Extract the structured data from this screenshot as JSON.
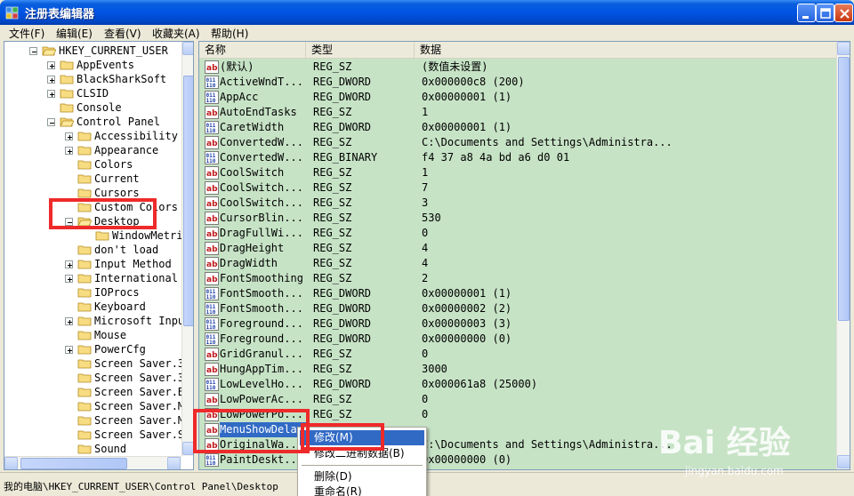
{
  "window": {
    "title": "注册表编辑器"
  },
  "menu": [
    "文件(F)",
    "编辑(E)",
    "查看(V)",
    "收藏夹(A)",
    "帮助(H)"
  ],
  "tree": [
    {
      "label": "HKEY_CURRENT_USER",
      "expander": "minus"
    },
    {
      "label": "AppEvents",
      "expander": "plus"
    },
    {
      "label": "BlackSharkSoft",
      "expander": "plus"
    },
    {
      "label": "CLSID",
      "expander": "plus"
    },
    {
      "label": "Console",
      "expander": ""
    },
    {
      "label": "Control Panel",
      "expander": "minus"
    },
    {
      "label": "Accessibility",
      "expander": "plus"
    },
    {
      "label": "Appearance",
      "expander": "plus"
    },
    {
      "label": "Colors",
      "expander": ""
    },
    {
      "label": "Current",
      "expander": ""
    },
    {
      "label": "Cursors",
      "expander": ""
    },
    {
      "label": "Custom Colors",
      "expander": ""
    },
    {
      "label": "Desktop",
      "expander": "minus"
    },
    {
      "label": "WindowMetrics",
      "expander": ""
    },
    {
      "label": "don't load",
      "expander": ""
    },
    {
      "label": "Input Method",
      "expander": "plus"
    },
    {
      "label": "International",
      "expander": "plus"
    },
    {
      "label": "IOProcs",
      "expander": ""
    },
    {
      "label": "Keyboard",
      "expander": ""
    },
    {
      "label": "Microsoft Input",
      "expander": "plus"
    },
    {
      "label": "Mouse",
      "expander": ""
    },
    {
      "label": "PowerCfg",
      "expander": "plus"
    },
    {
      "label": "Screen Saver.3",
      "expander": ""
    },
    {
      "label": "Screen Saver.3",
      "expander": ""
    },
    {
      "label": "Screen Saver.B",
      "expander": ""
    },
    {
      "label": "Screen Saver.M",
      "expander": ""
    },
    {
      "label": "Screen Saver.M",
      "expander": ""
    },
    {
      "label": "Screen Saver.S",
      "expander": ""
    },
    {
      "label": "Sound",
      "expander": ""
    }
  ],
  "list_headers": {
    "name": "名称",
    "type": "类型",
    "data": "数据"
  },
  "values": [
    {
      "name": "(默认)",
      "type": "REG_SZ",
      "data": "(数值未设置)",
      "icon": "ab"
    },
    {
      "name": "ActiveWndT...",
      "type": "REG_DWORD",
      "data": "0x000000c8 (200)",
      "icon": "bin"
    },
    {
      "name": "AppAcc",
      "type": "REG_DWORD",
      "data": "0x00000001 (1)",
      "icon": "bin"
    },
    {
      "name": "AutoEndTasks",
      "type": "REG_SZ",
      "data": "1",
      "icon": "ab"
    },
    {
      "name": "CaretWidth",
      "type": "REG_DWORD",
      "data": "0x00000001 (1)",
      "icon": "bin"
    },
    {
      "name": "ConvertedW...",
      "type": "REG_SZ",
      "data": "C:\\Documents and Settings\\Administra...",
      "icon": "ab"
    },
    {
      "name": "ConvertedW...",
      "type": "REG_BINARY",
      "data": "f4 37 a8 4a bd a6 d0 01",
      "icon": "bin"
    },
    {
      "name": "CoolSwitch",
      "type": "REG_SZ",
      "data": "1",
      "icon": "ab"
    },
    {
      "name": "CoolSwitch...",
      "type": "REG_SZ",
      "data": "7",
      "icon": "ab"
    },
    {
      "name": "CoolSwitch...",
      "type": "REG_SZ",
      "data": "3",
      "icon": "ab"
    },
    {
      "name": "CursorBlin...",
      "type": "REG_SZ",
      "data": "530",
      "icon": "ab"
    },
    {
      "name": "DragFullWi...",
      "type": "REG_SZ",
      "data": "0",
      "icon": "ab"
    },
    {
      "name": "DragHeight",
      "type": "REG_SZ",
      "data": "4",
      "icon": "ab"
    },
    {
      "name": "DragWidth",
      "type": "REG_SZ",
      "data": "4",
      "icon": "ab"
    },
    {
      "name": "FontSmoothing",
      "type": "REG_SZ",
      "data": "2",
      "icon": "ab"
    },
    {
      "name": "FontSmooth...",
      "type": "REG_DWORD",
      "data": "0x00000001 (1)",
      "icon": "bin"
    },
    {
      "name": "FontSmooth...",
      "type": "REG_DWORD",
      "data": "0x00000002 (2)",
      "icon": "bin"
    },
    {
      "name": "Foreground...",
      "type": "REG_DWORD",
      "data": "0x00000003 (3)",
      "icon": "bin"
    },
    {
      "name": "Foreground...",
      "type": "REG_DWORD",
      "data": "0x00000000 (0)",
      "icon": "bin"
    },
    {
      "name": "GridGranul...",
      "type": "REG_SZ",
      "data": "0",
      "icon": "ab"
    },
    {
      "name": "HungAppTim...",
      "type": "REG_SZ",
      "data": "3000",
      "icon": "ab"
    },
    {
      "name": "LowLevelHo...",
      "type": "REG_DWORD",
      "data": "0x000061a8 (25000)",
      "icon": "bin"
    },
    {
      "name": "LowPowerAc...",
      "type": "REG_SZ",
      "data": "0",
      "icon": "ab"
    },
    {
      "name": "LowPowerPo...",
      "type": "REG_SZ",
      "data": "0",
      "icon": "ab"
    },
    {
      "name": "MenuShowDelay",
      "type": "",
      "data": "",
      "icon": "ab",
      "selected": true
    },
    {
      "name": "OriginalWa...",
      "type": "",
      "data": "C:\\Documents and Settings\\Administra...",
      "icon": "ab"
    },
    {
      "name": "PaintDeskt...",
      "type": "",
      "data": "0x00000000 (0)",
      "icon": "bin"
    }
  ],
  "context_menu": {
    "modify": "修改(M)",
    "modify_binary": "修改二进制数据(B)",
    "delete": "删除(D)",
    "rename": "重命名(R)"
  },
  "status": "我的电脑\\HKEY_CURRENT_USER\\Control Panel\\Desktop",
  "watermark": {
    "brand": "Bai 经验",
    "url": "jingyan.baidu.com"
  },
  "colors": {
    "list_bg": "#c7e3c6",
    "selection": "#316ac5",
    "highlight_box": "#ee2a2a",
    "titlebar": "#0054e3"
  }
}
